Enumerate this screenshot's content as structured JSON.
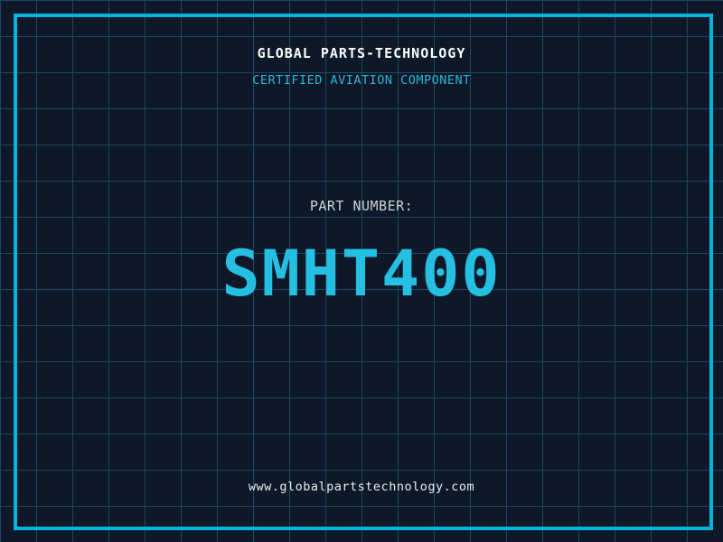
{
  "label": {
    "company_name": "GLOBAL PARTS-TECHNOLOGY",
    "certification_line": "CERTIFIED AVIATION COMPONENT",
    "part_number_label": "PART NUMBER:",
    "part_number": "SMHT400",
    "website": "www.globalpartstechnology.com"
  },
  "colors": {
    "background": "#0f1828",
    "grid_line": "#184a5e",
    "frame_border": "#00b4da",
    "part_number_cyan": "#25bfe1",
    "certification_cyan": "#2db4d6",
    "company_white": "#fafcfc",
    "label_gray": "#ccd2d8",
    "website_white": "#e9eef1"
  }
}
